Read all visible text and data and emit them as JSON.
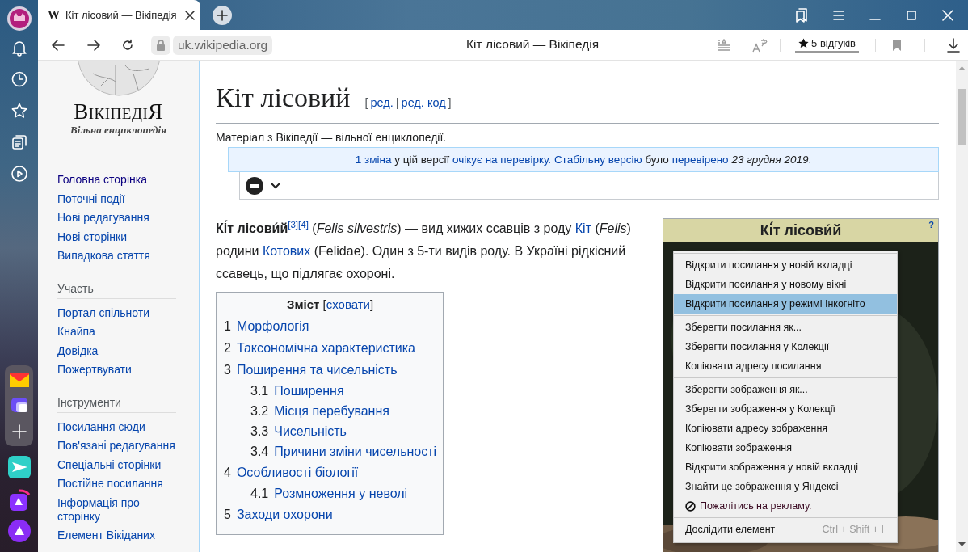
{
  "tab": {
    "favicon": "W",
    "title": "Кіт лісовий — Вікіпедія"
  },
  "toolbar": {
    "url": "uk.wikipedia.org",
    "page_title": "Кіт лісовий — Вікіпедія",
    "reviews": "5 відгуків"
  },
  "wiki_sidebar": {
    "logo_title": "ВікіпедіЯ",
    "logo_subtitle": "Вільна енциклопедія",
    "sections": [
      {
        "items": [
          {
            "label": "Головна сторінка",
            "visited": true
          },
          {
            "label": "Поточні події",
            "visited": false
          },
          {
            "label": "Нові редагування",
            "visited": false
          },
          {
            "label": "Нові сторінки",
            "visited": false
          },
          {
            "label": "Випадкова стаття",
            "visited": false
          }
        ]
      },
      {
        "heading": "Участь",
        "items": [
          {
            "label": "Портал спільноти",
            "visited": false
          },
          {
            "label": "Кнайпа",
            "visited": false
          },
          {
            "label": "Довідка",
            "visited": false
          },
          {
            "label": "Пожертвувати",
            "visited": false
          }
        ]
      },
      {
        "heading": "Інструменти",
        "items": [
          {
            "label": "Посилання сюди",
            "visited": false
          },
          {
            "label": "Пов'язані редагування",
            "visited": false
          },
          {
            "label": "Спеціальні сторінки",
            "visited": false
          },
          {
            "label": "Постійне посилання",
            "visited": false
          },
          {
            "label": "Інформація про сторінку",
            "visited": false
          },
          {
            "label": "Елемент Вікіданих",
            "visited": false
          }
        ]
      }
    ]
  },
  "article": {
    "title": "Кіт лісовий",
    "edit_links": {
      "open": "[",
      "links": [
        "ред.",
        "ред. код"
      ],
      "separator": "|",
      "close": "]"
    },
    "tagline": "Матеріал з Вікіпедії — вільної енциклопедії.",
    "review_notice": [
      {
        "kind": "link",
        "text": "1 зміна"
      },
      {
        "kind": "text",
        "text": " у цій версії "
      },
      {
        "kind": "link",
        "text": "очікує на перевірку."
      },
      {
        "kind": "link",
        "text": "Стабільну версію"
      },
      {
        "kind": "text",
        "text": " було "
      },
      {
        "kind": "link",
        "text": "перевірено"
      },
      {
        "kind": "text",
        "text": " *23 грудня 2019*."
      }
    ],
    "intro": [
      {
        "kind": "text",
        "text": "**Кі́т лісови́й**"
      },
      {
        "kind": "ref",
        "text": "[3]"
      },
      {
        "kind": "ref",
        "text": "[4]"
      },
      {
        "kind": "text",
        "text": " (*Felis silvestris*) — вид хижих ссавців з роду "
      },
      {
        "kind": "link",
        "text": "Кіт"
      },
      {
        "kind": "text",
        "text": " (*Felis*) родини "
      },
      {
        "kind": "link",
        "text": "Котових"
      },
      {
        "kind": "text",
        "text": " (Felidae). Один з 5-ти видів роду. В Україні рідкісний ссавець, що підлягає охороні."
      }
    ],
    "toc": {
      "title": "Зміст",
      "toggle": {
        "open": "[",
        "label": "сховати",
        "close": "]"
      },
      "items": [
        {
          "number": "1",
          "label": "Морфологія"
        },
        {
          "number": "2",
          "label": "Таксономічна характеристика"
        },
        {
          "number": "3",
          "label": "Поширення та чисельність",
          "children": [
            {
              "number": "3.1",
              "label": "Поширення"
            },
            {
              "number": "3.2",
              "label": "Місця перебування"
            },
            {
              "number": "3.3",
              "label": "Чисельність"
            },
            {
              "number": "3.4",
              "label": "Причини зміни чисельності"
            }
          ]
        },
        {
          "number": "4",
          "label": "Особливості біології",
          "children": [
            {
              "number": "4.1",
              "label": "Розмноження у неволі"
            }
          ]
        },
        {
          "number": "5",
          "label": "Заходи охорони"
        }
      ]
    }
  },
  "infobox": {
    "title": "Кі́т лісови́й",
    "help": "?"
  },
  "context_menu": {
    "groups": [
      [
        {
          "kind": "item",
          "label": "Відкрити посилання у новій вкладці",
          "selected": false
        },
        {
          "kind": "item",
          "label": "Відкрити посилання у новому вікні",
          "selected": false
        },
        {
          "kind": "item",
          "label": "Відкрити посилання у режимі Інкогніто",
          "selected": true
        }
      ],
      [
        {
          "kind": "item",
          "label": "Зберегти посилання як...",
          "selected": false
        },
        {
          "kind": "item",
          "label": "Зберегти посилання у Колекції",
          "selected": false
        },
        {
          "kind": "item",
          "label": "Копіювати адресу посилання",
          "selected": false
        }
      ],
      [
        {
          "kind": "item",
          "label": "Зберегти зображення як...",
          "selected": false
        },
        {
          "kind": "item",
          "label": "Зберегти зображення у Колекції",
          "selected": false
        },
        {
          "kind": "item",
          "label": "Копіювати адресу зображення",
          "selected": false
        },
        {
          "kind": "item",
          "label": "Копіювати зображення",
          "selected": false
        },
        {
          "kind": "item",
          "label": "Відкрити зображення у новій вкладці",
          "selected": false
        },
        {
          "kind": "item",
          "label": "Знайти це зображення у Яндексі",
          "selected": false
        },
        {
          "kind": "report",
          "label": "Пожалітись на рекламу.",
          "selected": false
        }
      ],
      [
        {
          "kind": "item",
          "label": "Дослідити елемент",
          "shortcut": "Ctrl + Shift + I",
          "selected": false
        }
      ]
    ]
  }
}
